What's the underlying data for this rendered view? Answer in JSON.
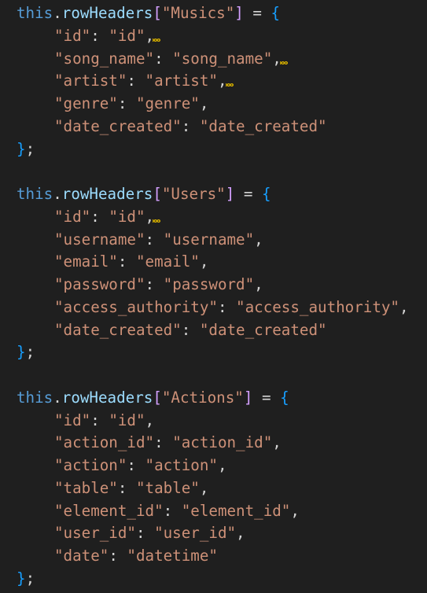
{
  "editor": {
    "blocks": [
      {
        "object": "this",
        "property": "rowHeaders",
        "key": "\"Musics\"",
        "entries": [
          {
            "k": "\"id\"",
            "v": "\"id\"",
            "comma": ",",
            "warn": true
          },
          {
            "k": "\"song_name\"",
            "v": "\"song_name\"",
            "comma": ",",
            "warn": true
          },
          {
            "k": "\"artist\"",
            "v": "\"artist\"",
            "comma": ",",
            "warn": true
          },
          {
            "k": "\"genre\"",
            "v": "\"genre\"",
            "comma": ",",
            "warn": false
          },
          {
            "k": "\"date_created\"",
            "v": "\"date_created\"",
            "comma": "",
            "warn": false
          }
        ]
      },
      {
        "object": "this",
        "property": "rowHeaders",
        "key": "\"Users\"",
        "entries": [
          {
            "k": "\"id\"",
            "v": "\"id\"",
            "comma": ",",
            "warn": true
          },
          {
            "k": "\"username\"",
            "v": "\"username\"",
            "comma": ",",
            "warn": false
          },
          {
            "k": "\"email\"",
            "v": "\"email\"",
            "comma": ",",
            "warn": false
          },
          {
            "k": "\"password\"",
            "v": "\"password\"",
            "comma": ",",
            "warn": false
          },
          {
            "k": "\"access_authority\"",
            "v": "\"access_authority\"",
            "comma": ",",
            "warn": false
          },
          {
            "k": "\"date_created\"",
            "v": "\"date_created\"",
            "comma": "",
            "warn": false
          }
        ]
      },
      {
        "object": "this",
        "property": "rowHeaders",
        "key": "\"Actions\"",
        "entries": [
          {
            "k": "\"id\"",
            "v": "\"id\"",
            "comma": ",",
            "warn": false
          },
          {
            "k": "\"action_id\"",
            "v": "\"action_id\"",
            "comma": ",",
            "warn": false
          },
          {
            "k": "\"action\"",
            "v": "\"action\"",
            "comma": ",",
            "warn": false
          },
          {
            "k": "\"table\"",
            "v": "\"table\"",
            "comma": ",",
            "warn": false
          },
          {
            "k": "\"element_id\"",
            "v": "\"element_id\"",
            "comma": ",",
            "warn": false
          },
          {
            "k": "\"user_id\"",
            "v": "\"user_id\"",
            "comma": ",",
            "warn": false
          },
          {
            "k": "\"date\"",
            "v": "\"datetime\"",
            "comma": "",
            "warn": false
          }
        ]
      }
    ]
  },
  "colors": {
    "background": "#1f1f1f",
    "keyword": "#569cd6",
    "property": "#9cdcfe",
    "string": "#ce9178",
    "bracket_square": "#d4a0ff",
    "bracket_curly": "#179fff",
    "warning_squiggle": "#cca700"
  }
}
